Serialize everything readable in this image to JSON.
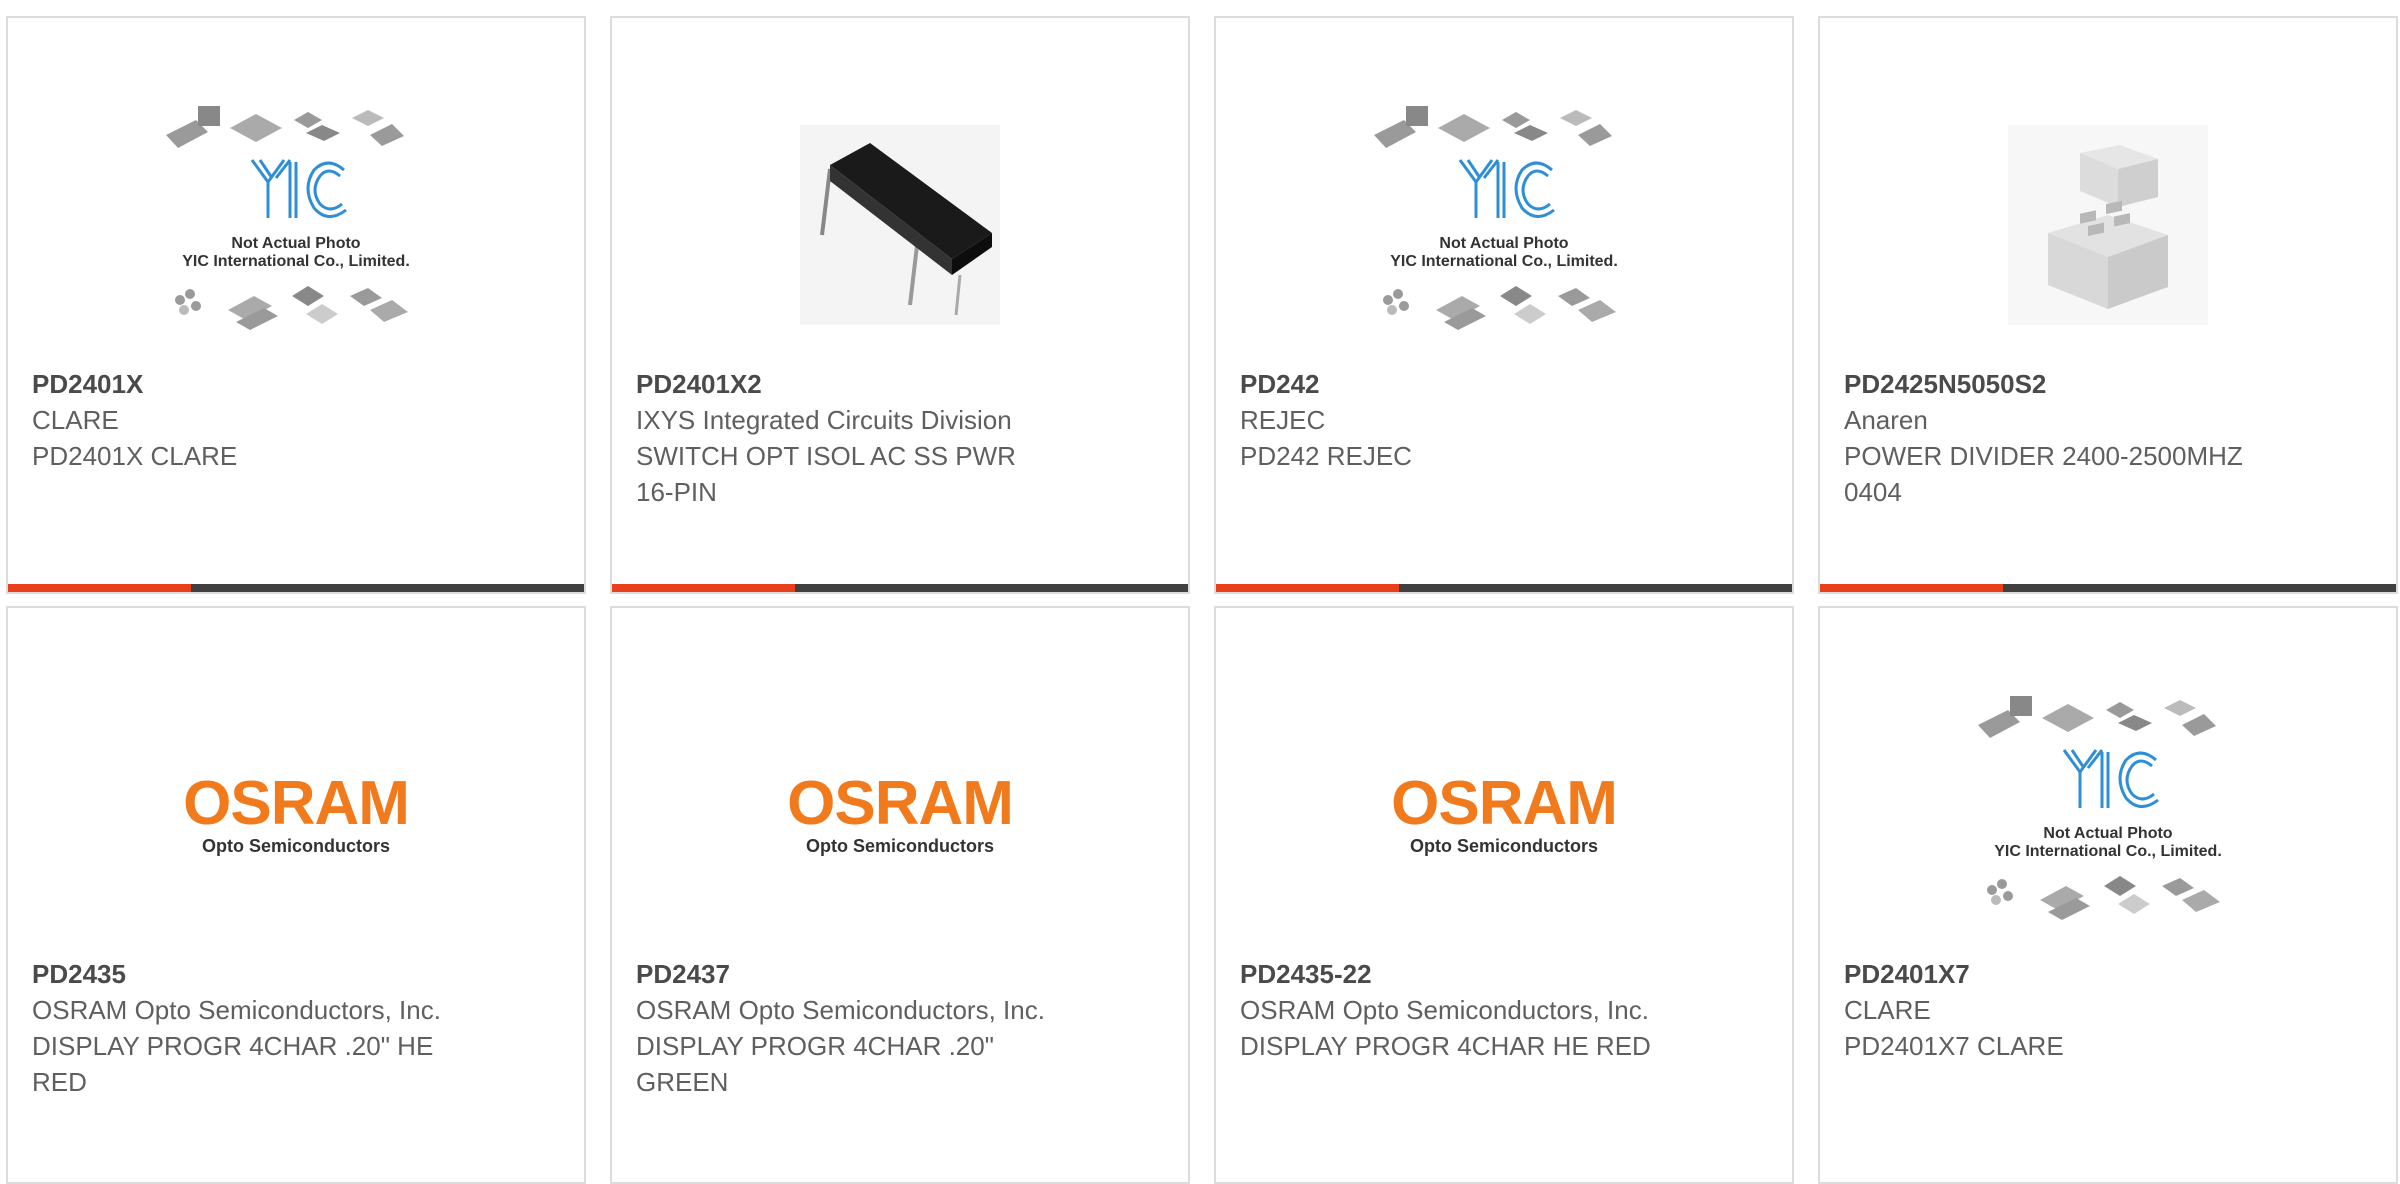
{
  "products": [
    {
      "image": {
        "type": "placeholder",
        "text_line1": "Not Actual Photo",
        "text_line2": "YIC International Co., Limited."
      },
      "part_number": "PD2401X",
      "manufacturer": "CLARE",
      "description": "PD2401X CLARE"
    },
    {
      "image": {
        "type": "dip-relay"
      },
      "part_number": "PD2401X2",
      "manufacturer": "IXYS Integrated Circuits Division",
      "description": "SWITCH OPT ISOL AC SS PWR 16-PIN"
    },
    {
      "image": {
        "type": "placeholder",
        "text_line1": "Not Actual Photo",
        "text_line2": "YIC International Co., Limited."
      },
      "part_number": "PD242",
      "manufacturer": "REJEC",
      "description": "PD242 REJEC"
    },
    {
      "image": {
        "type": "white-module"
      },
      "part_number": "PD2425N5050S2",
      "manufacturer": "Anaren",
      "description": "POWER DIVIDER 2400-2500MHZ 0404"
    },
    {
      "image": {
        "type": "osram-logo",
        "brand": "OSRAM",
        "sub": "Opto Semiconductors"
      },
      "part_number": "PD2435",
      "manufacturer": "OSRAM Opto Semiconductors, Inc.",
      "description": "DISPLAY PROGR 4CHAR .20\" HE RED"
    },
    {
      "image": {
        "type": "osram-logo",
        "brand": "OSRAM",
        "sub": "Opto Semiconductors"
      },
      "part_number": "PD2437",
      "manufacturer": "OSRAM Opto Semiconductors, Inc.",
      "description": "DISPLAY PROGR 4CHAR .20\" GREEN"
    },
    {
      "image": {
        "type": "osram-logo",
        "brand": "OSRAM",
        "sub": "Opto Semiconductors"
      },
      "part_number": "PD2435-22",
      "manufacturer": "OSRAM Opto Semiconductors, Inc.",
      "description": "DISPLAY PROGR 4CHAR HE RED"
    },
    {
      "image": {
        "type": "placeholder",
        "text_line1": "Not Actual Photo",
        "text_line2": "YIC International Co., Limited."
      },
      "part_number": "PD2401X7",
      "manufacturer": "CLARE",
      "description": "PD2401X7 CLARE"
    }
  ],
  "colors": {
    "accent": "#e8401c",
    "bar": "#404040",
    "osram": "#f07a1c",
    "yic_blue": "#2f8fd6"
  }
}
